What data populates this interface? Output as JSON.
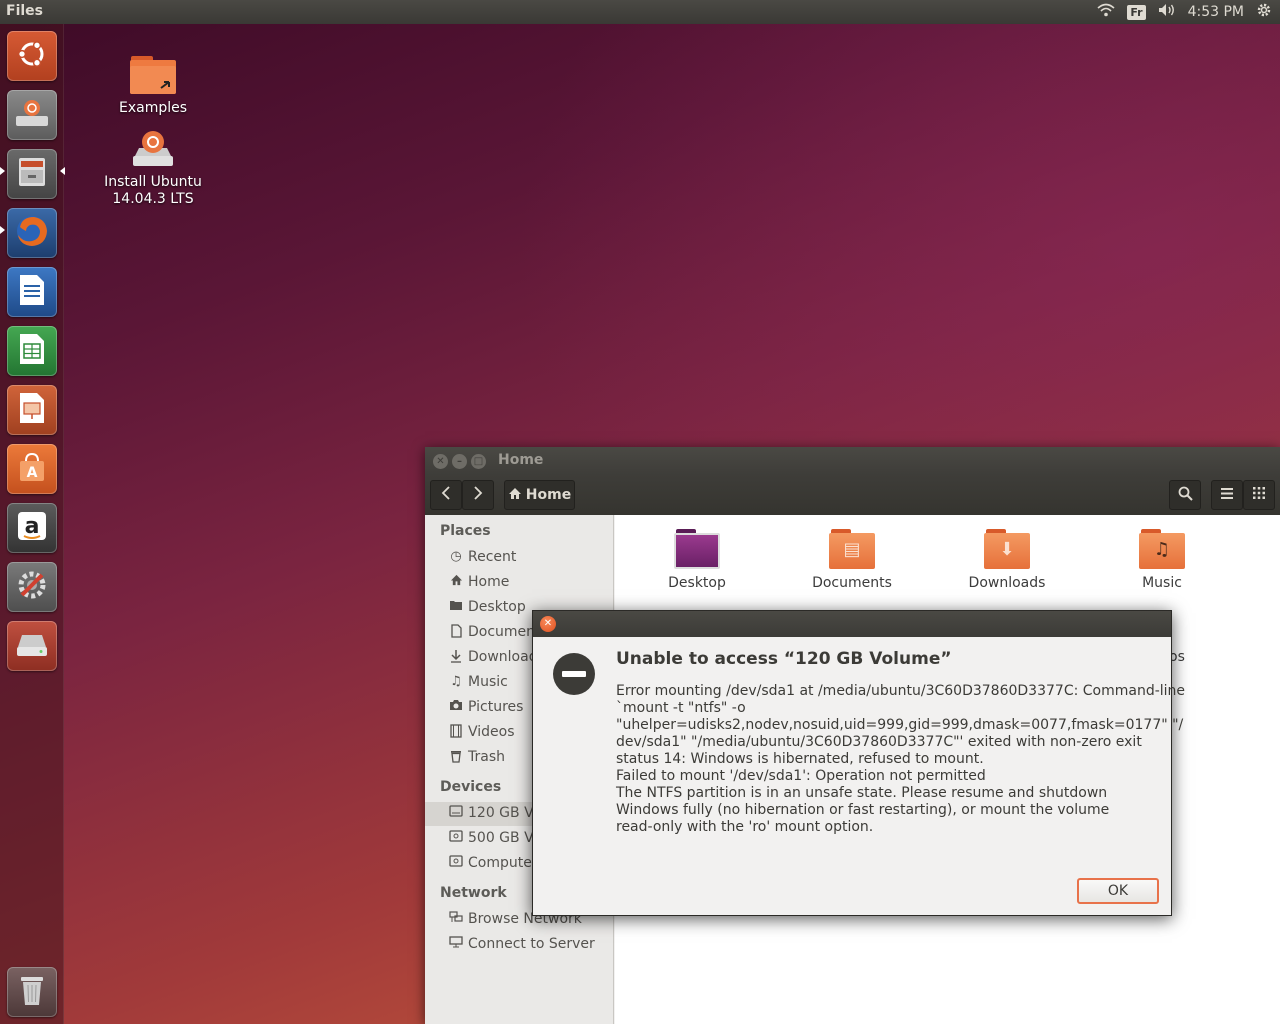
{
  "top_panel": {
    "app_title": "Files",
    "keyboard_layout": "Fr",
    "clock": "4:53 PM",
    "icons": [
      "wifi-icon",
      "volume-icon",
      "session-gear-icon"
    ]
  },
  "launcher": {
    "items": [
      {
        "name": "dash-home",
        "color": "#c64f2c"
      },
      {
        "name": "install-ubuntu",
        "color": "#6a6a6a"
      },
      {
        "name": "files",
        "color": "#5a5a5a"
      },
      {
        "name": "firefox",
        "color": "#d9591d"
      },
      {
        "name": "libreoffice-writer",
        "color": "#2a62a8"
      },
      {
        "name": "libreoffice-calc",
        "color": "#2d8a3a"
      },
      {
        "name": "libreoffice-impress",
        "color": "#c64f2c"
      },
      {
        "name": "ubuntu-software-center",
        "color": "#e05d24"
      },
      {
        "name": "amazon",
        "color": "#4a4a4a"
      },
      {
        "name": "system-settings",
        "color": "#b03a2e"
      },
      {
        "name": "drive",
        "color": "#b84535"
      },
      {
        "name": "trash",
        "color": "#6a5656"
      }
    ]
  },
  "desktop": {
    "icons": [
      {
        "label": "Examples"
      },
      {
        "label_line1": "Install Ubuntu",
        "label_line2": "14.04.3 LTS"
      }
    ]
  },
  "files_window": {
    "title": "Home",
    "breadcrumb": "Home",
    "sidebar": {
      "places_header": "Places",
      "places": [
        {
          "label": "Recent",
          "icon": "clock-icon"
        },
        {
          "label": "Home",
          "icon": "home-icon"
        },
        {
          "label": "Desktop",
          "icon": "folder-icon"
        },
        {
          "label": "Documents",
          "icon": "document-icon"
        },
        {
          "label": "Downloads",
          "icon": "download-icon"
        },
        {
          "label": "Music",
          "icon": "music-icon"
        },
        {
          "label": "Pictures",
          "icon": "camera-icon"
        },
        {
          "label": "Videos",
          "icon": "film-icon"
        },
        {
          "label": "Trash",
          "icon": "trash-icon"
        }
      ],
      "devices_header": "Devices",
      "devices": [
        {
          "label": "120 GB Volume",
          "icon": "drive-icon"
        },
        {
          "label": "500 GB Volume",
          "icon": "drive-icon"
        },
        {
          "label": "Computer",
          "icon": "drive-icon"
        }
      ],
      "network_header": "Network",
      "network": [
        {
          "label": "Browse Network",
          "icon": "network-icon"
        },
        {
          "label": "Connect to Server",
          "icon": "server-icon"
        }
      ]
    },
    "folders": [
      {
        "label": "Desktop",
        "color": "#7b2a74"
      },
      {
        "label": "Documents",
        "color": "#e8743f"
      },
      {
        "label": "Downloads",
        "color": "#e8743f"
      },
      {
        "label": "Music",
        "color": "#e8743f"
      }
    ],
    "partial_folder_label": "os"
  },
  "dialog": {
    "heading": "Unable to access “120 GB Volume”",
    "body_lines": [
      "Error mounting /dev/sda1 at /media/ubuntu/3C60D37860D3377C: Command-line",
      "`mount -t \"ntfs\" -o",
      "\"uhelper=udisks2,nodev,nosuid,uid=999,gid=999,dmask=0077,fmask=0177\" \"/",
      "dev/sda1\" \"/media/ubuntu/3C60D37860D3377C\"' exited with non-zero exit",
      "status 14: Windows is hibernated, refused to mount.",
      "Failed to mount '/dev/sda1': Operation not permitted",
      "The NTFS partition is in an unsafe state. Please resume and shutdown",
      "Windows fully (no hibernation or fast restarting), or mount the volume",
      "read-only with the 'ro' mount option."
    ],
    "ok_label": "OK",
    "accent_color": "#e8724a"
  }
}
